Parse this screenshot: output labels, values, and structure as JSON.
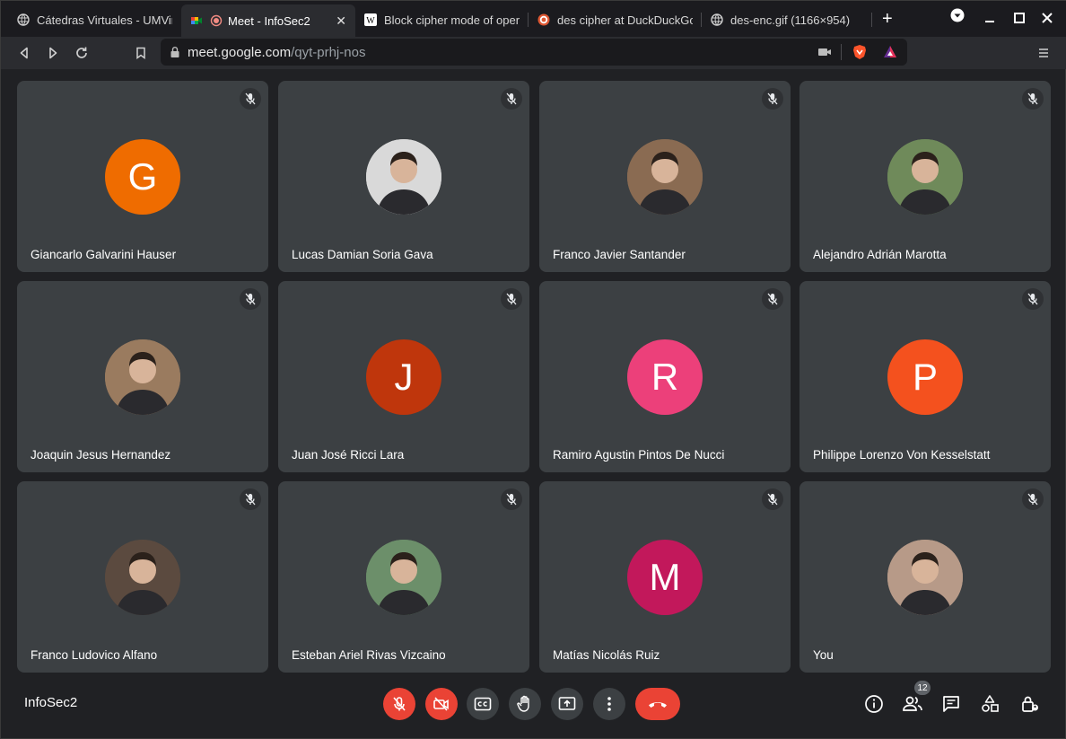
{
  "browser": {
    "tabs": [
      {
        "title": "Cátedras Virtuales - UMVirt",
        "favicon": "globe-icon"
      },
      {
        "title": "Meet - InfoSec2",
        "favicon": "meet-icon",
        "recording": true
      },
      {
        "title": "Block cipher mode of operation",
        "favicon": "wikipedia-icon"
      },
      {
        "title": "des cipher at DuckDuckGo",
        "favicon": "duckduckgo-icon"
      },
      {
        "title": "des-enc.gif (1166×954)",
        "favicon": "globe-icon"
      }
    ],
    "close_glyph": "✕",
    "new_tab_glyph": "+",
    "url_host": "meet.google.com",
    "url_path": "/qyt-prhj-nos"
  },
  "participants": [
    {
      "name": "Giancarlo Galvarini Hauser",
      "initial": "G",
      "color": "#ef6c00",
      "photo": false
    },
    {
      "name": "Lucas Damian Soria Gava",
      "initial": "",
      "color": "#d9d9d9",
      "photo": true
    },
    {
      "name": "Franco Javier Santander",
      "initial": "",
      "color": "#8a6b52",
      "photo": true
    },
    {
      "name": "Alejandro Adrián Marotta",
      "initial": "",
      "color": "#6f8a5a",
      "photo": true
    },
    {
      "name": "Joaquin Jesus Hernandez",
      "initial": "",
      "color": "#9a7b5f",
      "photo": true
    },
    {
      "name": "Juan José Ricci Lara",
      "initial": "J",
      "color": "#bf360c",
      "photo": false
    },
    {
      "name": "Ramiro Agustin Pintos De Nucci",
      "initial": "R",
      "color": "#ec407a",
      "photo": false
    },
    {
      "name": "Philippe Lorenzo Von Kesselstatt",
      "initial": "P",
      "color": "#f4511e",
      "photo": false
    },
    {
      "name": "Franco Ludovico Alfano",
      "initial": "",
      "color": "#5b4a3f",
      "photo": true
    },
    {
      "name": "Esteban Ariel Rivas Vizcaino",
      "initial": "",
      "color": "#6c8f6a",
      "photo": true
    },
    {
      "name": "Matías Nicolás Ruiz",
      "initial": "M",
      "color": "#c2185b",
      "photo": false
    },
    {
      "name": "You",
      "initial": "",
      "color": "#b79a88",
      "photo": true
    }
  ],
  "meeting": {
    "title": "InfoSec2",
    "participant_count": "12"
  },
  "colors": {
    "background": "#202124",
    "tile": "#3c4043",
    "danger": "#ea4335"
  }
}
